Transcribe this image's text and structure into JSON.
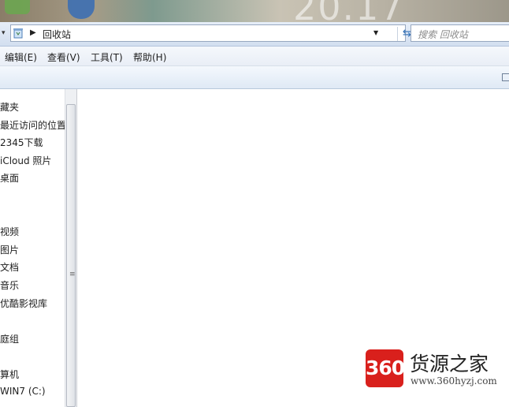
{
  "desktop": {
    "clock_fragment": "20.17"
  },
  "address_bar": {
    "location": "回收站",
    "search_placeholder": "搜索 回收站"
  },
  "menu": [
    "编辑(E)",
    "查看(V)",
    "工具(T)",
    "帮助(H)"
  ],
  "nav_pane": {
    "items": [
      "藏夹",
      "最近访问的位置",
      "2345下载",
      "iCloud 照片",
      "桌面",
      "视频",
      "图片",
      "文档",
      "音乐",
      "优酷影视库",
      "庭组",
      "算机",
      "WIN7 (C:)"
    ]
  },
  "watermark": {
    "logo": "360",
    "title": "货源之家",
    "url": "www.360hyzj.com"
  }
}
